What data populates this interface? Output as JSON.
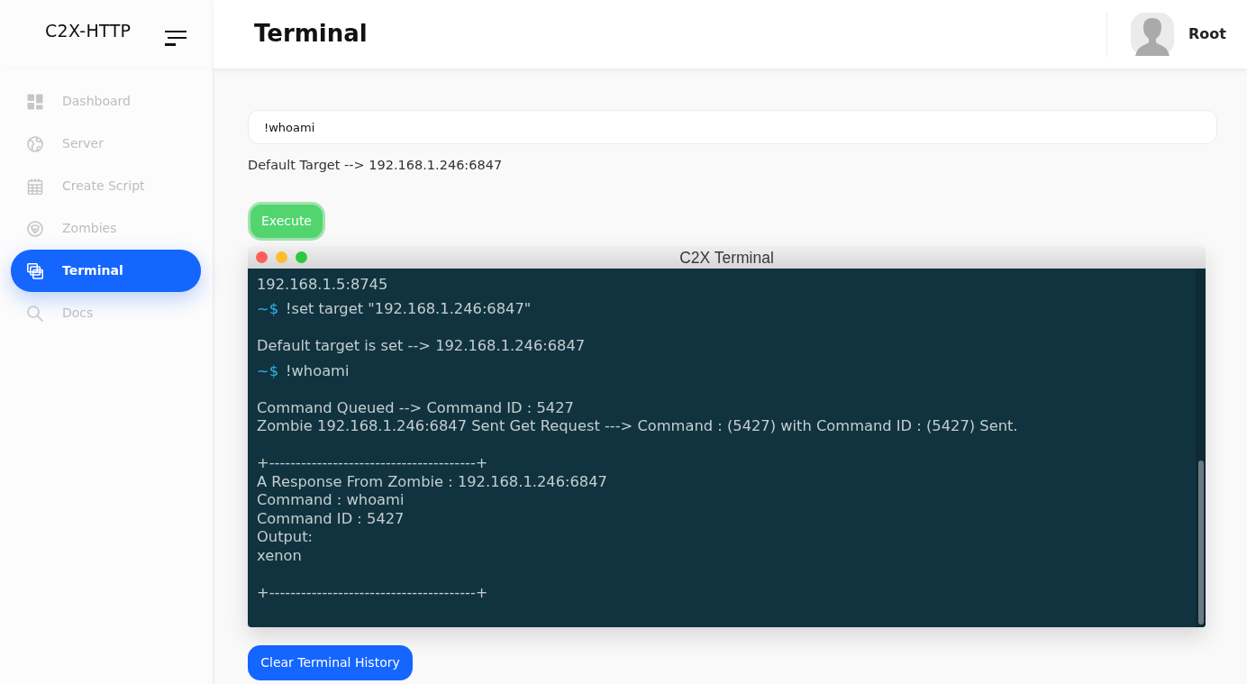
{
  "sidebar": {
    "logo": "C2X-HTTP",
    "items": [
      {
        "label": "Dashboard",
        "selected": false
      },
      {
        "label": "Server",
        "selected": false
      },
      {
        "label": "Create Script",
        "selected": false
      },
      {
        "label": "Zombies",
        "selected": false
      },
      {
        "label": "Terminal",
        "selected": true
      },
      {
        "label": "Docs",
        "selected": false
      }
    ]
  },
  "header": {
    "title": "Terminal",
    "user": {
      "name": "Root"
    }
  },
  "command": {
    "value": "!whoami",
    "target_note": "Default Target --> 192.168.1.246:6847",
    "execute_button": {
      "label": "Execute",
      "focused": true
    }
  },
  "terminal": {
    "title": "C2X Terminal",
    "lines": [
      {
        "kind": "output",
        "text": "192.168.1.5:8745"
      },
      {
        "kind": "command",
        "prompt": "~$",
        "text": "!set target \"192.168.1.246:6847\""
      },
      {
        "kind": "output",
        "text": "Default target is set --> 192.168.1.246:6847",
        "space_before": true
      },
      {
        "kind": "command",
        "prompt": "~$",
        "text": "!whoami"
      },
      {
        "kind": "output",
        "text": "Command Queued --> Command ID : 5427",
        "space_before": true
      },
      {
        "kind": "output",
        "text": "Zombie 192.168.1.246:6847 Sent Get Request ---> Command : (5427) with Command ID : (5427) Sent."
      },
      {
        "kind": "output",
        "text": "+---------------------------------------+",
        "space_before": true
      },
      {
        "kind": "output",
        "text": "A Response From Zombie : 192.168.1.246:6847"
      },
      {
        "kind": "output",
        "text": "Command : whoami"
      },
      {
        "kind": "output",
        "text": "Command ID : 5427"
      },
      {
        "kind": "output",
        "text": "Output:"
      },
      {
        "kind": "output",
        "text": "xenon"
      },
      {
        "kind": "output",
        "text": "+---------------------------------------+",
        "space_before": true
      }
    ]
  },
  "clear_button": {
    "label": "Clear Terminal History"
  }
}
